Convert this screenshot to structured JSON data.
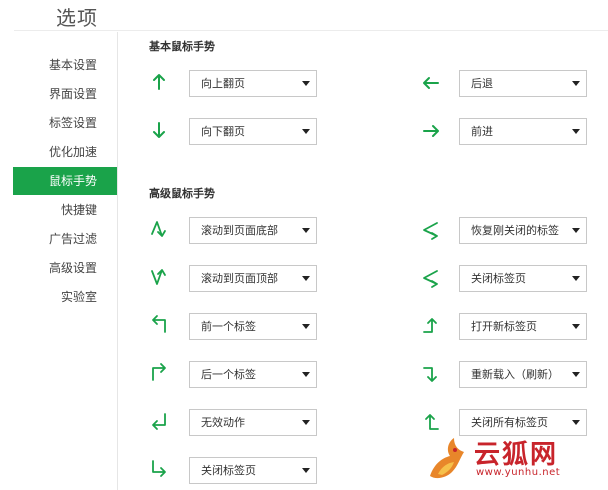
{
  "page": {
    "title": "选项"
  },
  "sidebar": {
    "items": [
      {
        "label": "基本设置"
      },
      {
        "label": "界面设置"
      },
      {
        "label": "标签设置"
      },
      {
        "label": "优化加速"
      },
      {
        "label": "鼠标手势",
        "active": true
      },
      {
        "label": "快捷键"
      },
      {
        "label": "广告过滤"
      },
      {
        "label": "高级设置"
      },
      {
        "label": "实验室"
      }
    ]
  },
  "basic": {
    "title": "基本鼠标手势",
    "gestures": [
      {
        "icon": "arrow-up-icon",
        "value": "向上翻页"
      },
      {
        "icon": "arrow-left-icon",
        "value": "后退"
      },
      {
        "icon": "arrow-down-icon",
        "value": "向下翻页"
      },
      {
        "icon": "arrow-right-icon",
        "value": "前进"
      }
    ]
  },
  "advanced": {
    "title": "高级鼠标手势",
    "gestures": [
      {
        "icon": "gesture-up-down-icon",
        "value": "滚动到页面底部"
      },
      {
        "icon": "gesture-left-right-icon",
        "value": "恢复刚关闭的标签"
      },
      {
        "icon": "gesture-down-up-icon",
        "value": "滚动到页面顶部"
      },
      {
        "icon": "gesture-right-left-icon",
        "value": "关闭标签页"
      },
      {
        "icon": "gesture-up-left-icon",
        "value": "前一个标签"
      },
      {
        "icon": "gesture-right-up-icon",
        "value": "打开新标签页"
      },
      {
        "icon": "gesture-up-right-icon",
        "value": "后一个标签"
      },
      {
        "icon": "gesture-right-down-icon",
        "value": "重新载入（刷新）"
      },
      {
        "icon": "gesture-down-left-icon",
        "value": "无效动作"
      },
      {
        "icon": "gesture-left-up-icon",
        "value": "关闭所有标签页"
      },
      {
        "icon": "gesture-down-right-icon",
        "value": "关闭标签页"
      }
    ]
  },
  "watermark": {
    "brand": "云狐网",
    "site": "www.yunhu.net"
  },
  "colors": {
    "accent": "#1aa34a",
    "watermark": "#c8242b"
  }
}
